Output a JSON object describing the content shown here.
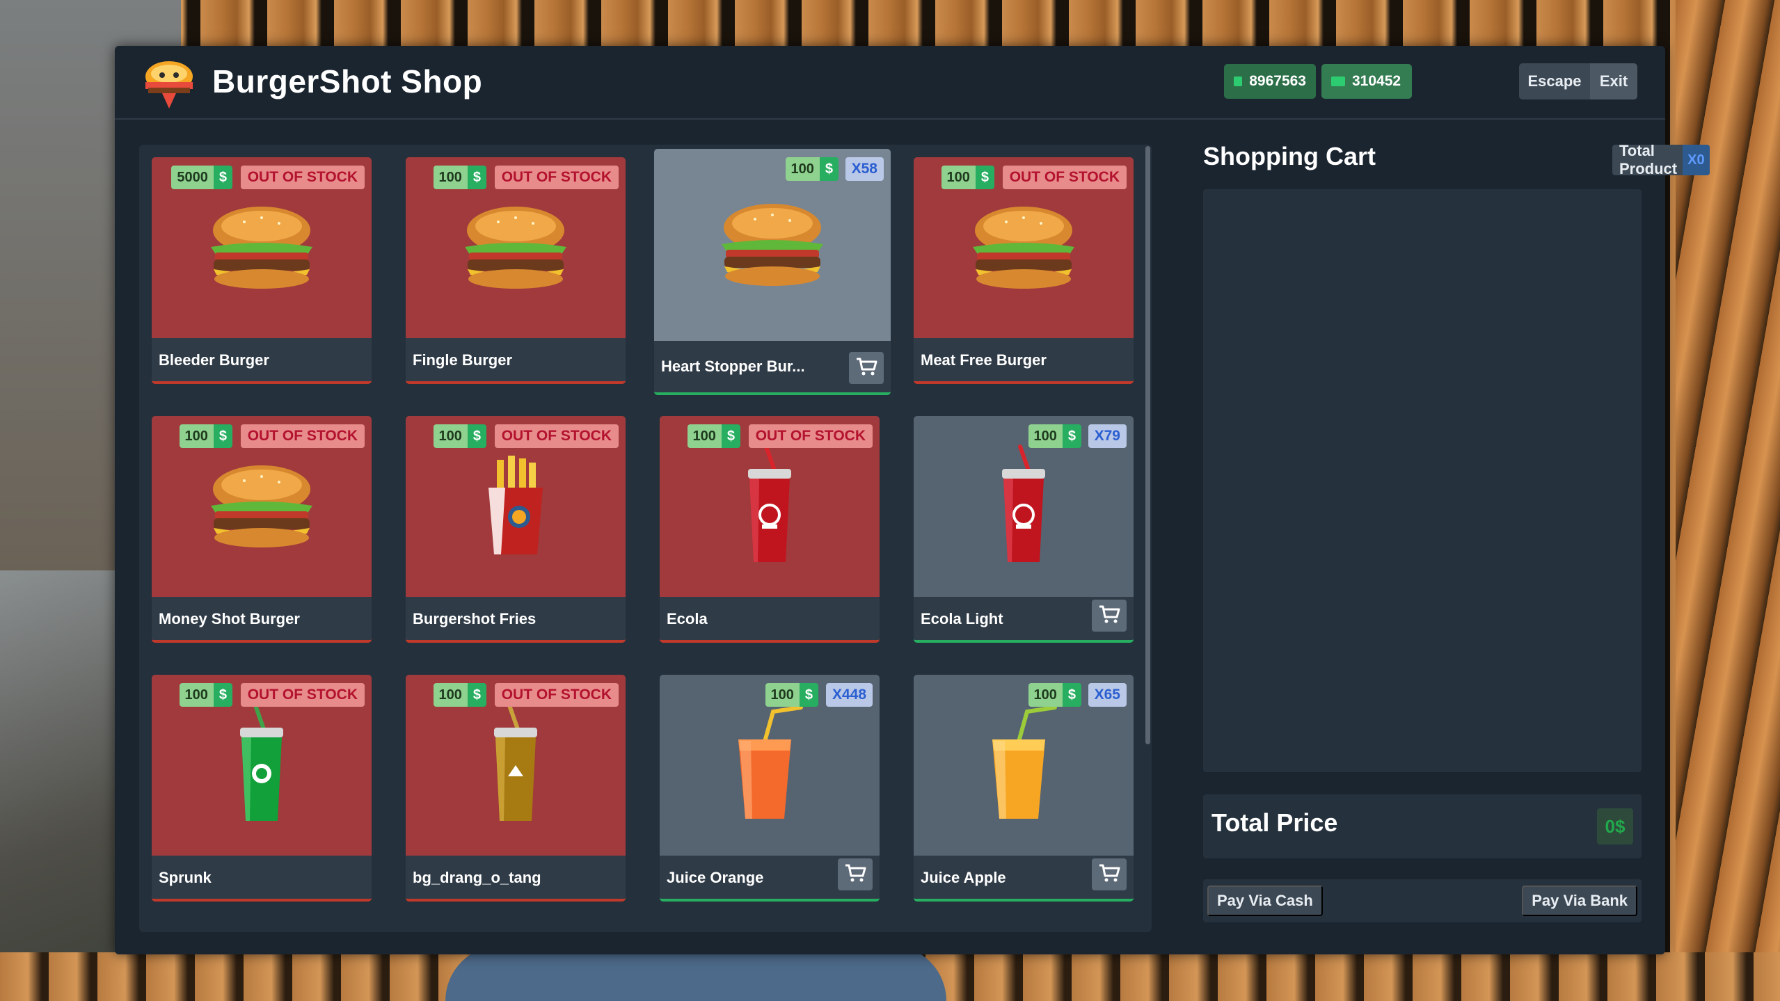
{
  "header": {
    "title": "BurgerShot Shop",
    "cash": "8967563",
    "bank": "310452",
    "escape_label": "Escape",
    "exit_label": "Exit"
  },
  "products": [
    {
      "name": "Bleeder Burger",
      "price": "5000",
      "currency": "$",
      "status": "OUT OF STOCK",
      "in_stock": false,
      "icon": "burger"
    },
    {
      "name": "Fingle Burger",
      "price": "100",
      "currency": "$",
      "status": "OUT OF STOCK",
      "in_stock": false,
      "icon": "burger"
    },
    {
      "name": "Heart Stopper Bur...",
      "price": "100",
      "currency": "$",
      "status": "X58",
      "in_stock": true,
      "icon": "burger"
    },
    {
      "name": "Meat Free Burger",
      "price": "100",
      "currency": "$",
      "status": "OUT OF STOCK",
      "in_stock": false,
      "icon": "burger"
    },
    {
      "name": "Money Shot Burger",
      "price": "100",
      "currency": "$",
      "status": "OUT OF STOCK",
      "in_stock": false,
      "icon": "burger"
    },
    {
      "name": "Burgershot Fries",
      "price": "100",
      "currency": "$",
      "status": "OUT OF STOCK",
      "in_stock": false,
      "icon": "fries"
    },
    {
      "name": "Ecola",
      "price": "100",
      "currency": "$",
      "status": "OUT OF STOCK",
      "in_stock": false,
      "icon": "soda-red"
    },
    {
      "name": "Ecola Light",
      "price": "100",
      "currency": "$",
      "status": "X79",
      "in_stock": true,
      "icon": "soda-red"
    },
    {
      "name": "Sprunk",
      "price": "100",
      "currency": "$",
      "status": "OUT OF STOCK",
      "in_stock": false,
      "icon": "soda-green"
    },
    {
      "name": "bg_drang_o_tang",
      "price": "100",
      "currency": "$",
      "status": "OUT OF STOCK",
      "in_stock": false,
      "icon": "soda-gold"
    },
    {
      "name": "Juice Orange",
      "price": "100",
      "currency": "$",
      "status": "X448",
      "in_stock": true,
      "icon": "juice-orange"
    },
    {
      "name": "Juice Apple",
      "price": "100",
      "currency": "$",
      "status": "X65",
      "in_stock": true,
      "icon": "juice-apple"
    }
  ],
  "cart": {
    "title": "Shopping Cart",
    "total_product_label": "Total Product",
    "total_product_count": "X0",
    "total_price_label": "Total Price",
    "total_price_value": "0$",
    "pay_cash_label": "Pay Via Cash",
    "pay_bank_label": "Pay Via Bank"
  },
  "colors": {
    "out_of_stock_bg": "#a13a3c",
    "in_stock_bg": "#566472",
    "price_green": "#27ae60",
    "oos_text": "#b3122e",
    "qty_text": "#2b5fd1"
  }
}
